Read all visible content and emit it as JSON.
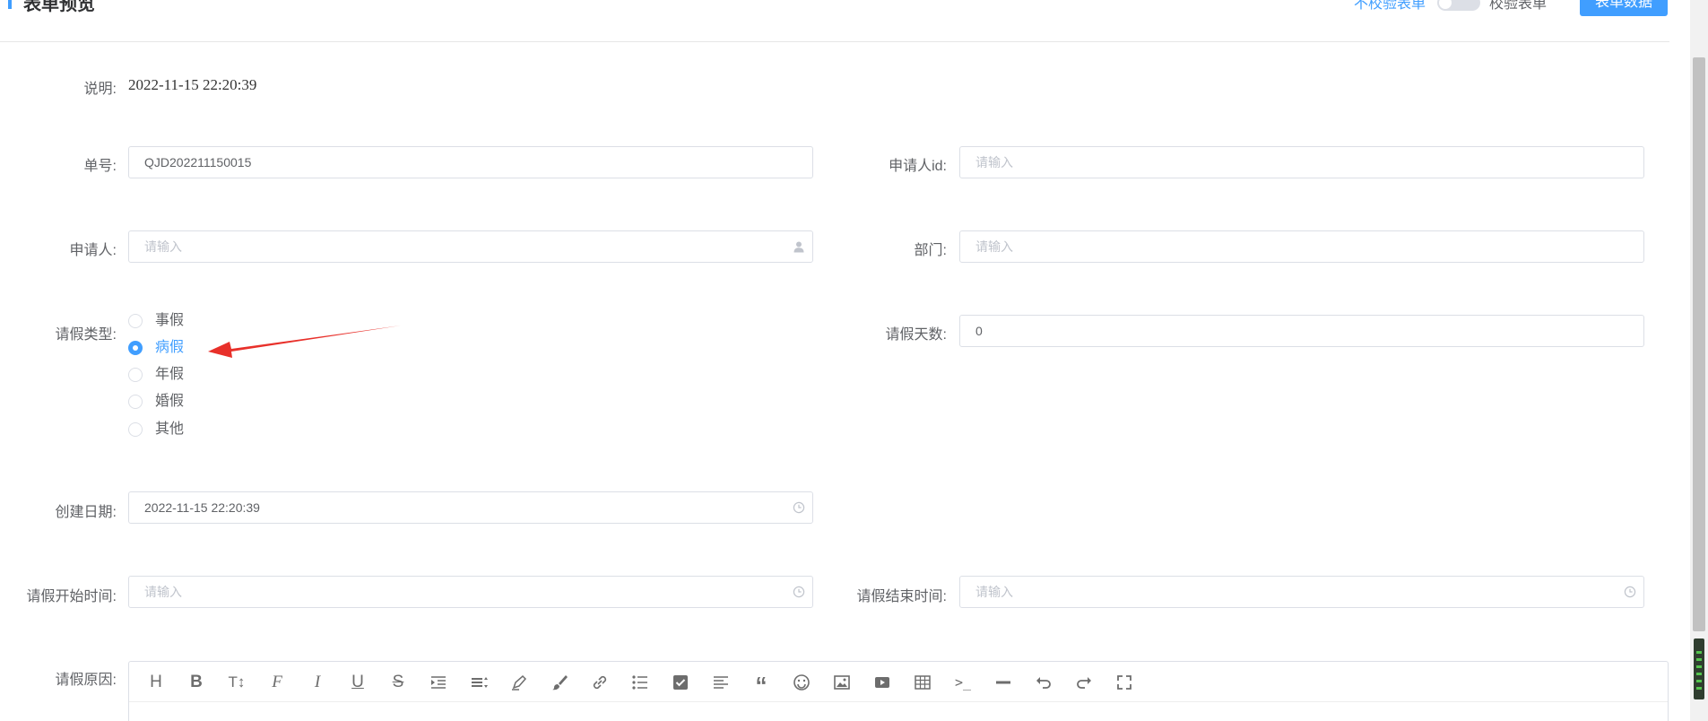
{
  "header": {
    "title": "表单预览",
    "no_validate_label": "不校验表单",
    "validate_label": "校验表单",
    "form_data_button": "表单数据"
  },
  "form": {
    "description": {
      "label": "说明:",
      "value": "2022-11-15 22:20:39"
    },
    "order_no": {
      "label": "单号:",
      "value": "QJD202211150015"
    },
    "applicant_id": {
      "label": "申请人id:",
      "placeholder": "请输入"
    },
    "applicant": {
      "label": "申请人:",
      "placeholder": "请输入"
    },
    "department": {
      "label": "部门:",
      "placeholder": "请输入"
    },
    "leave_type": {
      "label": "请假类型:",
      "options": [
        "事假",
        "病假",
        "年假",
        "婚假",
        "其他"
      ],
      "selected": "病假"
    },
    "leave_days": {
      "label": "请假天数:",
      "value": "0"
    },
    "created_date": {
      "label": "创建日期:",
      "value": "2022-11-15 22:20:39"
    },
    "leave_start": {
      "label": "请假开始时间:",
      "placeholder": "请输入"
    },
    "leave_end": {
      "label": "请假结束时间:",
      "placeholder": "请输入"
    },
    "leave_reason": {
      "label": "请假原因:"
    }
  },
  "editor_toolbar": [
    "heading-icon",
    "bold-icon",
    "font-size-icon",
    "font-family-icon",
    "italic-icon",
    "underline-icon",
    "strikethrough-icon",
    "indent-icon",
    "line-height-icon",
    "highlight-icon",
    "brush-icon",
    "link-icon",
    "bullet-list-icon",
    "checkbox-icon",
    "align-icon",
    "quote-icon",
    "emoji-icon",
    "image-icon",
    "video-icon",
    "table-icon",
    "code-icon",
    "divider-icon",
    "undo-icon",
    "redo-icon",
    "fullscreen-icon"
  ],
  "colors": {
    "primary": "#409eff",
    "arrow": "#e8302a",
    "border": "#dcdfe6"
  }
}
